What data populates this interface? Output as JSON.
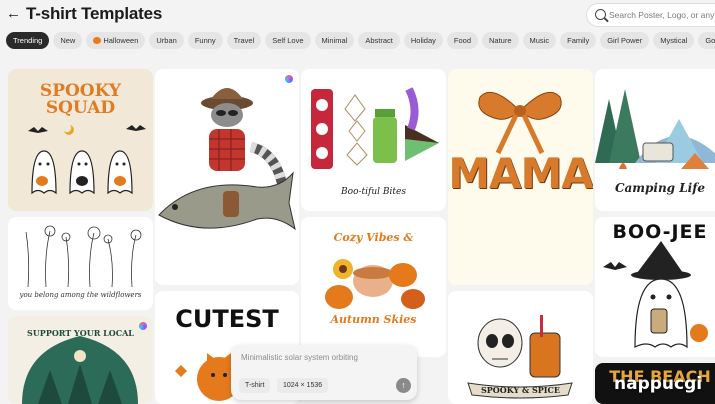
{
  "header": {
    "title": "T-shirt Templates",
    "back_icon": "arrow-left-icon",
    "search_placeholder": "Search Poster, Logo, or anything"
  },
  "categories": [
    {
      "label": "Trending",
      "active": true
    },
    {
      "label": "New"
    },
    {
      "label": "Halloween",
      "icon": "pumpkin-icon"
    },
    {
      "label": "Urban"
    },
    {
      "label": "Funny"
    },
    {
      "label": "Travel"
    },
    {
      "label": "Self Love"
    },
    {
      "label": "Minimal"
    },
    {
      "label": "Abstract"
    },
    {
      "label": "Holiday"
    },
    {
      "label": "Food"
    },
    {
      "label": "Nature"
    },
    {
      "label": "Music"
    },
    {
      "label": "Family"
    },
    {
      "label": "Girl Power"
    },
    {
      "label": "Mystical"
    },
    {
      "label": "Gothic"
    }
  ],
  "templates": {
    "spooky_squad": "SPOOKY SQUAD",
    "wildflowers": "you belong among the wildflowers",
    "support_local": "SUPPORT YOUR LOCAL",
    "cutest": "CUTEST",
    "bootiful": "Boo-tiful Bites",
    "cozy_line1": "Cozy Vibes &",
    "cozy_line2": "Autumn Skies",
    "mama": "MAMA",
    "spooky_spice": "SPOOKY & SPICE",
    "camping": "Camping Life",
    "boojee": "BOO-JEE",
    "beach": "THE BEACH"
  },
  "prompt": {
    "placeholder": "Minimalistic solar system orbiting",
    "type_chip": "T-shirt",
    "size_chip": "1024 × 1536"
  },
  "watermark": "nappucgi",
  "colors": {
    "active_chip": "#2a2a2a",
    "orange": "#e47a1c"
  }
}
